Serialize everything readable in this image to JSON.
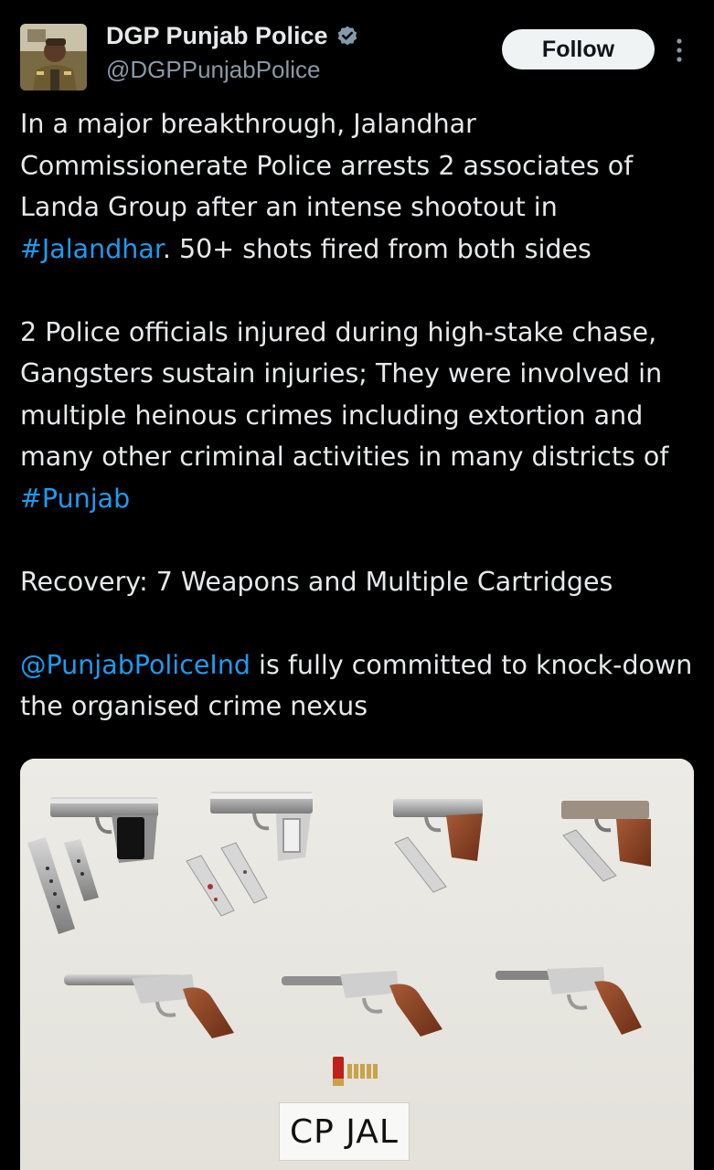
{
  "post": {
    "author": {
      "display_name": "DGP Punjab Police",
      "handle": "@DGPPunjabPolice",
      "verified_icon": "verified-badge-icon",
      "avatar_icon": "profile-avatar"
    },
    "follow_label": "Follow",
    "more_icon": "more-vertical-icon",
    "text": {
      "p1_a": "In a major breakthrough, Jalandhar Commissionerate Police arrests 2 associates of Landa Group after an intense shootout in ",
      "p1_hashtag": "#Jalandhar",
      "p1_b": ". 50+ shots fired from both sides",
      "p2_a": "2 Police officials injured during high-stake chase, Gangsters sustain injuries; They were involved in multiple heinous crimes including extortion and many other criminal activities in many districts of ",
      "p2_hashtag": "#Punjab",
      "p3": "Recovery: 7 Weapons and Multiple Cartridges",
      "p4_mention": "@PunjabPoliceInd",
      "p4_b": " is fully committed to knock-down the organised crime nexus"
    },
    "media": {
      "label": "CP  JAL",
      "items": [
        "pistol",
        "pistol",
        "pistol",
        "pistol",
        "country-made pistol",
        "country-made pistol",
        "country-made pistol",
        "magazine",
        "cartridges"
      ]
    },
    "colors": {
      "background": "#000000",
      "text": "#e7e9ea",
      "secondary_text": "#8b98a5",
      "link": "#1d9bf0",
      "verified": "#829aab"
    }
  }
}
